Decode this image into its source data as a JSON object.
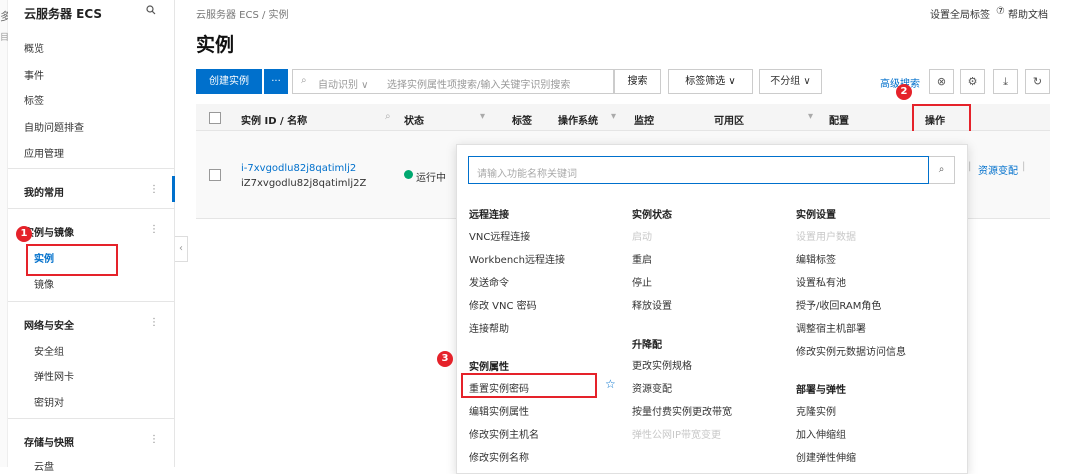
{
  "left_strip": {
    "glyph_top": "多",
    "glyph_mid": "目"
  },
  "sidebar": {
    "title": "云服务器 ECS",
    "search_icon": "search-icon",
    "items": [
      "概览",
      "事件",
      "标签",
      "自助问题排查",
      "应用管理"
    ],
    "favorites_label": "我的常用",
    "groups": [
      {
        "label": "实例与镜像",
        "children": [
          "实例",
          "镜像"
        ]
      },
      {
        "label": "网络与安全",
        "children": [
          "安全组",
          "弹性网卡",
          "密钥对"
        ]
      },
      {
        "label": "存储与快照",
        "children": [
          "云盘"
        ]
      }
    ],
    "more_icon": "⋮",
    "collapse_icon": "‹"
  },
  "header": {
    "breadcrumb": "云服务器 ECS / 实例",
    "global_tags": "设置全局标签",
    "help_icon": "⑦",
    "help_docs": "帮助文档",
    "title": "实例"
  },
  "toolbar": {
    "create": "创建实例",
    "more": "···",
    "search_icon": "⌕",
    "search_type": "自动识别 ∨",
    "search_placeholder": "选择实例属性项搜索/输入关键字识别搜索",
    "search_btn": "搜索",
    "tag_filter": "标签筛选 ∨",
    "group": "不分组 ∨",
    "advanced": "高级搜索",
    "icons": [
      "⊗",
      "⚙",
      "⤓",
      "↻"
    ]
  },
  "table": {
    "headers": {
      "id": "实例 ID / 名称",
      "status": "状态",
      "tags": "标签",
      "os": "操作系统",
      "monitor": "监控",
      "zone": "可用区",
      "config": "配置",
      "actions": "操作"
    },
    "filter_icon": "filter-icon",
    "row": {
      "id": "i-7xvgodlu82j8qatimlj2",
      "name": "iZ7xvgodlu82j8qatimlj2Z",
      "status": "运行中",
      "action_link": "资源变配"
    }
  },
  "popup": {
    "placeholder": "请输入功能名称关键词",
    "search_icon": "⌕",
    "col1": {
      "h1": "远程连接",
      "items1": [
        "VNC远程连接",
        "Workbench远程连接",
        "发送命令",
        "修改 VNC 密码",
        "连接帮助"
      ],
      "h2": "实例属性",
      "items2": [
        "重置实例密码",
        "编辑实例属性",
        "修改实例主机名",
        "修改实例名称"
      ]
    },
    "col2": {
      "h1": "实例状态",
      "items1": [
        "启动",
        "重启",
        "停止",
        "释放设置"
      ],
      "h2": "升降配",
      "items2": [
        "更改实例规格",
        "资源变配",
        "按量付费实例更改带宽",
        "弹性公网IP带宽变更"
      ]
    },
    "col3": {
      "h1": "实例设置",
      "items1": [
        "设置用户数据",
        "编辑标签",
        "设置私有池",
        "授予/收回RAM角色",
        "调整宿主机部署",
        "修改实例元数据访问信息"
      ],
      "h2": "部署与弹性",
      "items2": [
        "克隆实例",
        "加入伸缩组",
        "创建弹性伸缩"
      ]
    },
    "star_icon": "☆"
  },
  "annotations": {
    "badge1": "1",
    "badge2": "2",
    "badge3": "3"
  },
  "colors": {
    "primary": "#0070cc",
    "annotation": "#e5222a",
    "running": "#00a870"
  }
}
